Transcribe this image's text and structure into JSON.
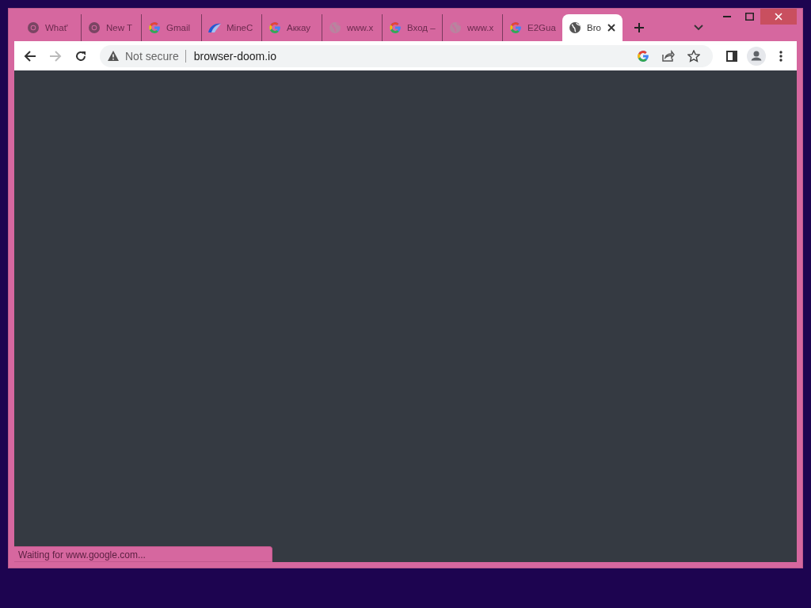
{
  "tabs": [
    {
      "title": "What'",
      "kind": "chrome",
      "selected": false
    },
    {
      "title": "New T",
      "kind": "chrome",
      "selected": false
    },
    {
      "title": "Gmail",
      "kind": "google",
      "selected": false
    },
    {
      "title": "MineC",
      "kind": "wave",
      "selected": false
    },
    {
      "title": "Аккау",
      "kind": "google",
      "selected": false
    },
    {
      "title": "www.x",
      "kind": "dimglobe",
      "selected": false
    },
    {
      "title": "Вход –",
      "kind": "google",
      "selected": false
    },
    {
      "title": "www.x",
      "kind": "dimglobe",
      "selected": false
    },
    {
      "title": "E2Gua",
      "kind": "google",
      "selected": false
    },
    {
      "title": "Bro",
      "kind": "globe",
      "selected": true
    }
  ],
  "toolbar": {
    "security_label": "Not secure",
    "url": "browser-doom.io"
  },
  "status_bar": "Waiting for www.google.com..."
}
